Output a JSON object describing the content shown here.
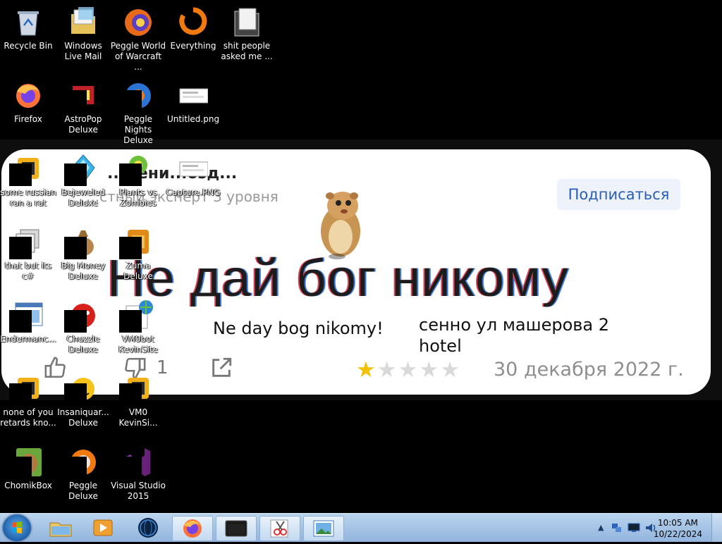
{
  "desktop_icons": [
    {
      "label": "Recycle Bin",
      "icon": "recycle-bin-icon"
    },
    {
      "label": "Windows Live Mail",
      "icon": "mail-folder-icon"
    },
    {
      "label": "Peggle World of Warcraft ...",
      "icon": "peggle-wow-icon"
    },
    {
      "label": "Everything",
      "icon": "everything-search-icon"
    },
    {
      "label": "shit people asked me ...",
      "icon": "folder-icon"
    },
    {
      "label": "Firefox",
      "icon": "firefox-icon"
    },
    {
      "label": "AstroPop Deluxe",
      "icon": "astropop-icon"
    },
    {
      "label": "Peggle Nights Deluxe",
      "icon": "peggle-nights-icon"
    },
    {
      "label": "Untitled.png",
      "icon": "image-file-icon"
    },
    {
      "label": "some russian ran a rat",
      "icon": "app-icon"
    },
    {
      "label": "Bejeweled Deluxe",
      "icon": "bejeweled-icon"
    },
    {
      "label": "Plants vs Zombies",
      "icon": "pvz-icon"
    },
    {
      "label": "Capture.PNG",
      "icon": "image-file-icon"
    },
    {
      "label": "that but its c#",
      "icon": "shortcut-icon"
    },
    {
      "label": "Big Money Deluxe",
      "icon": "money-bag-icon"
    },
    {
      "label": "Zuma Deluxe",
      "icon": "zuma-icon"
    },
    {
      "label": "Endermanc...",
      "icon": "window-app-icon"
    },
    {
      "label": "Chuzzle Deluxe",
      "icon": "chuzzle-icon"
    },
    {
      "label": "VM0bot KevinSite",
      "icon": "web-page-icon"
    },
    {
      "label": "none of you retards kno...",
      "icon": "app-icon"
    },
    {
      "label": "Insaniquar... Deluxe",
      "icon": "insaniquarium-icon"
    },
    {
      "label": "VM0 KevinSi...",
      "icon": "app-icon"
    },
    {
      "label": "ChomikBox",
      "icon": "chomikbox-icon"
    },
    {
      "label": "Peggle Deluxe",
      "icon": "peggle-icon"
    },
    {
      "label": "Visual Studio 2015",
      "icon": "visual-studio-icon"
    }
  ],
  "wallpaper": {
    "author": "...дени...озд...",
    "subtitle": "...стный эксперт 3 уровня",
    "subscribe": "Подписаться",
    "headline": "Не дай бог никому",
    "transliteration": "Ne day bog nikomy!",
    "address": "сенно ул машерова 2 hotel",
    "dislike_count": "1",
    "rating": 1,
    "rating_max": 5,
    "date": "30 декабря 2022 г.",
    "colors": {
      "star_on": "#f2c200",
      "star_off": "#d9d9d9",
      "subscribe_text": "#2a5db8"
    }
  },
  "taskbar": {
    "pinned": [
      "explorer-icon",
      "media-player-icon",
      "globe-app-icon",
      "firefox-icon",
      "terminal-icon",
      "snipping-tool-icon",
      "photo-viewer-icon"
    ],
    "clock_time": "10:05 AM",
    "clock_date": "10/22/2024"
  }
}
